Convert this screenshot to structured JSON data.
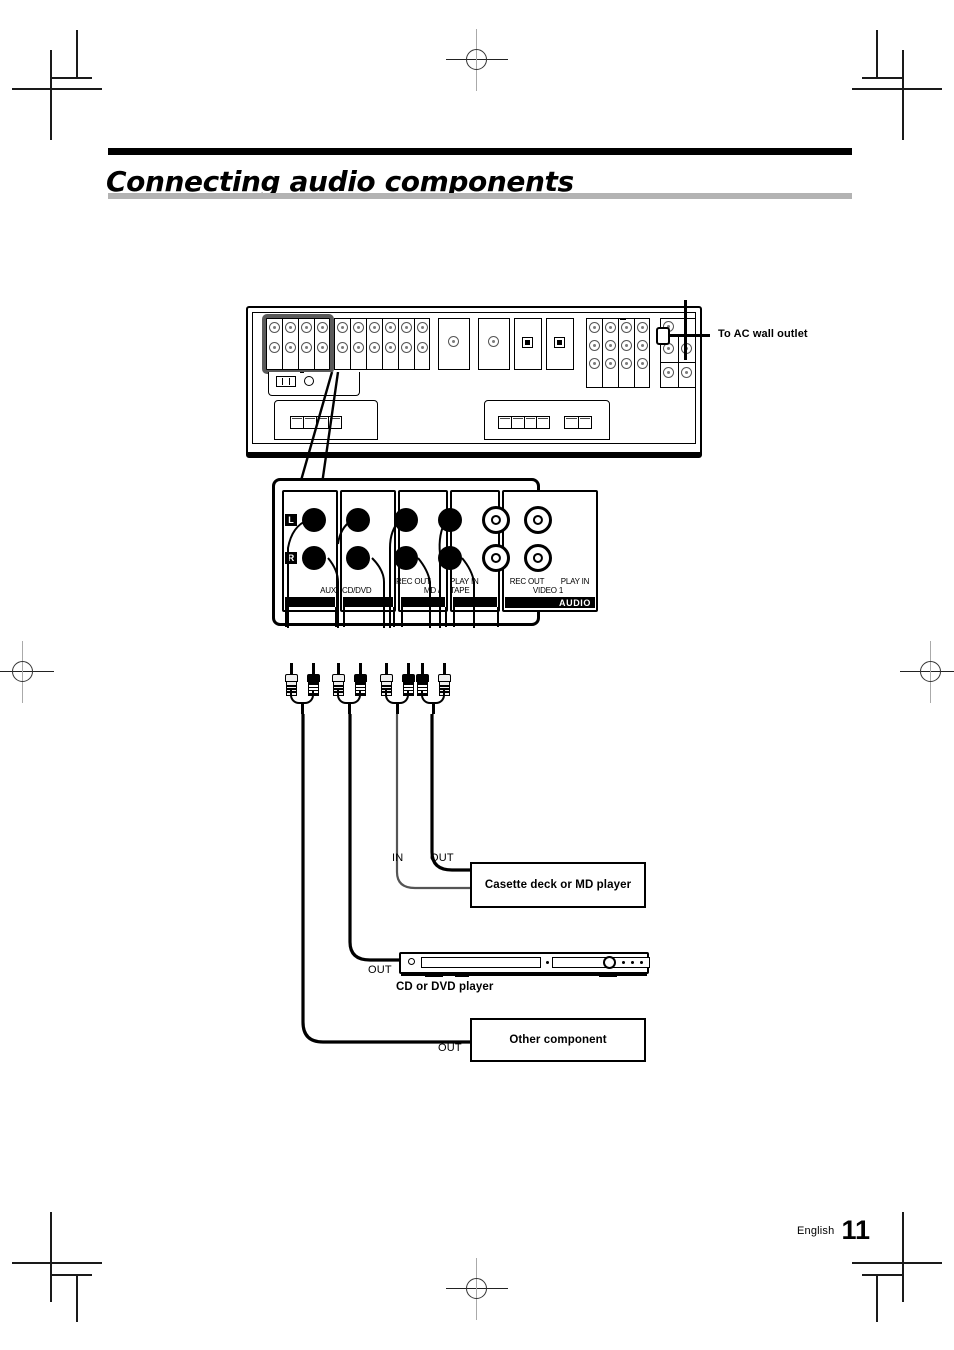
{
  "page": {
    "title": "Connecting audio components",
    "footer_language": "English",
    "footer_page_number": "11"
  },
  "callouts": {
    "ac_outlet": "To AC wall outlet"
  },
  "rear_panel": {
    "highlight_color": "#5a5a5a",
    "jack_groups": [
      {
        "name": "audio-inputs-highlighted",
        "columns": 4,
        "rows": 2
      },
      {
        "name": "audio-jacks-b",
        "columns": 6,
        "rows": 2
      },
      {
        "name": "video-jacks",
        "columns": 2,
        "rows": 1
      },
      {
        "name": "digital-jacks",
        "columns": 2,
        "rows": 1
      },
      {
        "name": "multichannel-jacks",
        "columns": 4,
        "rows": 3
      },
      {
        "name": "preout-jacks",
        "columns": 2,
        "rows": 3
      }
    ],
    "speaker_terminals": [
      {
        "name": "speaker-terminal-left",
        "posts": 4
      },
      {
        "name": "speaker-terminal-center",
        "posts": 4
      },
      {
        "name": "speaker-terminal-right",
        "posts": 2
      }
    ]
  },
  "detail_panel": {
    "channel_tags": [
      "L",
      "R"
    ],
    "band_label": "AUDIO",
    "jack_columns": [
      {
        "label_top": "",
        "label_bottom": "AUX",
        "type": "rca-black"
      },
      {
        "label_top": "",
        "label_bottom": "CD/DVD",
        "type": "rca-black"
      },
      {
        "label_top": "REC OUT",
        "label_bottom": "MD /",
        "type": "rca-black"
      },
      {
        "label_top": "PLAY IN",
        "label_bottom": "TAPE",
        "type": "rca-black"
      },
      {
        "label_top": "REC OUT",
        "label_bottom": "VIDEO 1",
        "type": "rca-ring"
      },
      {
        "label_top": "PLAY IN",
        "label_bottom": "",
        "type": "rca-ring"
      }
    ]
  },
  "cables": {
    "count": 4,
    "plug_colors": [
      "white",
      "black"
    ]
  },
  "components": [
    {
      "id": "cassette-md",
      "label": "Casette deck or MD player",
      "ports": [
        "IN",
        "OUT"
      ]
    },
    {
      "id": "cd-dvd",
      "label": "CD or DVD player",
      "ports": [
        "OUT"
      ]
    },
    {
      "id": "other",
      "label": "Other component",
      "ports": [
        "OUT"
      ]
    }
  ]
}
